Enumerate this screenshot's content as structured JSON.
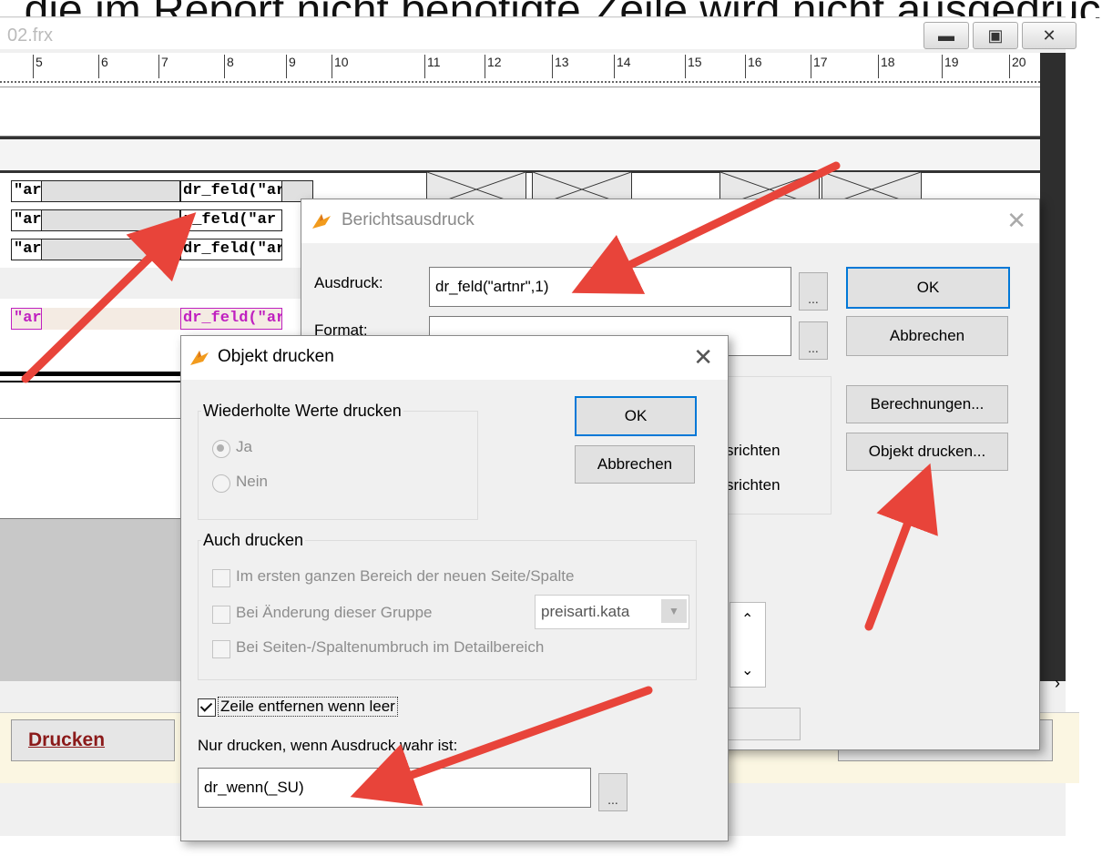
{
  "caption": ", die im Report nicht benötigte Zeile wird nicht ausgedruckt, so dass die Leerzeile verhindert und die nächste Zeile nach oben verschoben wird ... rg",
  "window": {
    "title": "02.frx",
    "minimize_icon": "minimize-icon",
    "maximize_icon": "maximize-icon",
    "close_icon": "close-icon"
  },
  "ruler": {
    "ticks": [
      "5",
      "6",
      "7",
      "8",
      "9",
      "10",
      "11",
      "12",
      "13",
      "14",
      "15",
      "16",
      "17",
      "18",
      "19",
      "20"
    ]
  },
  "report_fields": {
    "left_field_text": "\"ar",
    "mid_field_text": "dr_feld(\"ar",
    "mid_field_text_2": "r_feld(\"ar"
  },
  "drucken_label": "Drucken",
  "berichtsausdruck": {
    "title": "Berichtsausdruck",
    "ausdruck_label": "Ausdruck:",
    "ausdruck_value": "dr_feld(\"artnr\",1)",
    "format_label": "Format:",
    "format_value": "",
    "dots": "...",
    "ok": "OK",
    "abbrechen": "Abbrechen",
    "berechnungen": "Berechnungen...",
    "objekt_drucken": "Objekt drucken...",
    "align_1": "srichten",
    "align_2": "srichten"
  },
  "objekt_drucken": {
    "title": "Objekt drucken",
    "wiederholte_label": "Wiederholte Werte drucken",
    "ja": "Ja",
    "nein": "Nein",
    "ok": "OK",
    "abbrechen": "Abbrechen",
    "auch_drucken_label": "Auch drucken",
    "option_1": "Im ersten ganzen Bereich der neuen Seite/Spalte",
    "option_2": "Bei Änderung dieser Gruppe",
    "option_3": "Bei Seiten-/Spaltenumbruch im Detailbereich",
    "group_select": "preisarti.kata",
    "zeile_entfernen": "Zeile entfernen wenn leer",
    "zeile_entfernen_checked": true,
    "nur_drucken_label": "Nur drucken, wenn Ausdruck wahr ist:",
    "nur_drucken_value": "dr_wenn(_SU)",
    "dots": "..."
  },
  "colors": {
    "arrow": "#e8443a",
    "accent": "#0078d7",
    "pink_field": "#c020c0",
    "drucken_text": "#8b1a1a"
  }
}
